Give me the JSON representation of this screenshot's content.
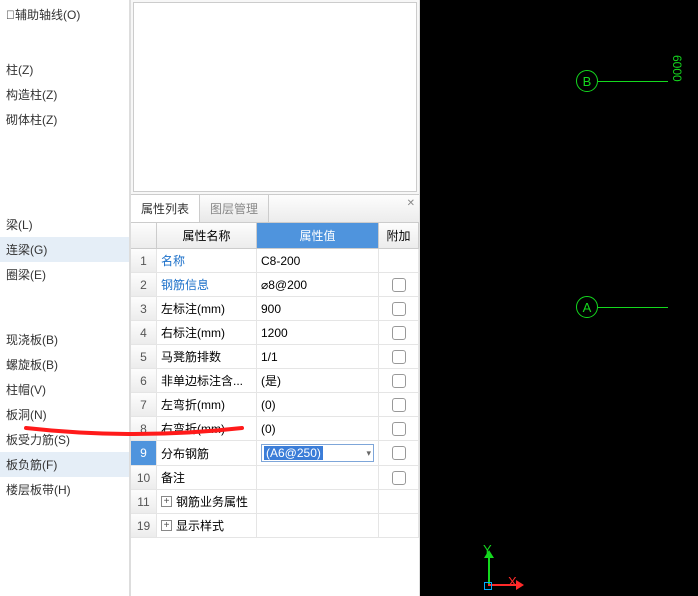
{
  "left_items_top": [
    {
      "label": "􏰀辅助轴线(O)",
      "sel": false
    }
  ],
  "left_items_mid": [
    {
      "label": "柱(Z)",
      "sel": false
    },
    {
      "label": "构造柱(Z)",
      "sel": false
    },
    {
      "label": "砌体柱(Z)",
      "sel": false
    }
  ],
  "left_items_beam": [
    {
      "label": "梁(L)",
      "sel": false
    },
    {
      "label": "连梁(G)",
      "sel": true
    },
    {
      "label": "圈梁(E)",
      "sel": false
    }
  ],
  "left_items_slab": [
    {
      "label": "现浇板(B)",
      "sel": false
    },
    {
      "label": "螺旋板(B)",
      "sel": false
    },
    {
      "label": "柱帽(V)",
      "sel": false
    },
    {
      "label": "板洞(N)",
      "sel": false
    },
    {
      "label": "板受力筋(S)",
      "sel": false
    },
    {
      "label": "板负筋(F)",
      "sel": true
    },
    {
      "label": "楼层板带(H)",
      "sel": false
    }
  ],
  "tabs": {
    "list": "属性列表",
    "layer": "图层管理"
  },
  "headers": {
    "name": "属性名称",
    "value": "属性值",
    "extra": "附加"
  },
  "rows": [
    {
      "n": "1",
      "name": "名称",
      "val": "C8-200",
      "link": true,
      "chk": false,
      "noextra": true
    },
    {
      "n": "2",
      "name": "钢筋信息",
      "val": "⌀8@200",
      "link": true,
      "chk": true
    },
    {
      "n": "3",
      "name": "左标注(mm)",
      "val": "900",
      "chk": true
    },
    {
      "n": "4",
      "name": "右标注(mm)",
      "val": "1200",
      "chk": true
    },
    {
      "n": "5",
      "name": "马凳筋排数",
      "val": "1/1",
      "chk": true
    },
    {
      "n": "6",
      "name": "非单边标注含...",
      "val": "(是)",
      "chk": true
    },
    {
      "n": "7",
      "name": "左弯折(mm)",
      "val": "(0)",
      "chk": true
    },
    {
      "n": "8",
      "name": "右弯折(mm)",
      "val": "(0)",
      "chk": true
    },
    {
      "n": "9",
      "name": "分布钢筋",
      "val": "(A6@250)",
      "chk": true,
      "selected": true,
      "dropdown": true
    },
    {
      "n": "10",
      "name": "备注",
      "val": "",
      "chk": true
    },
    {
      "n": "11",
      "name": "钢筋业务属性",
      "val": "",
      "expand": true,
      "noextra": true
    },
    {
      "n": "19",
      "name": "显示样式",
      "val": "",
      "expand": true,
      "noextra": true
    }
  ],
  "canvas": {
    "badgeA": "A",
    "badgeB": "B",
    "dim": "6000",
    "axisX": "X",
    "axisY": "Y"
  }
}
